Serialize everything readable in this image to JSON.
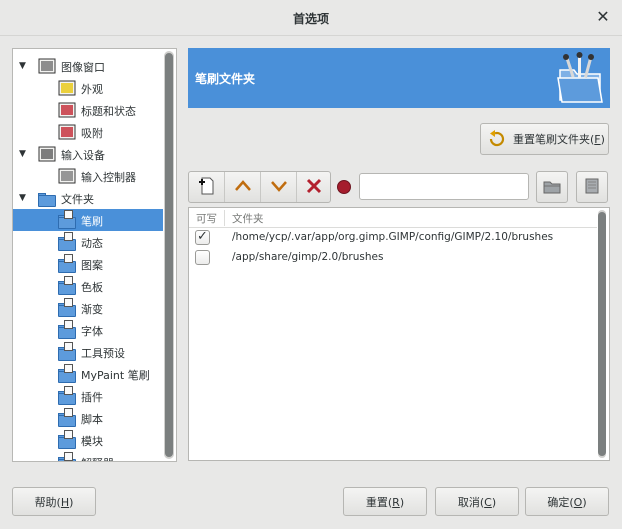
{
  "window": {
    "title": "首选项"
  },
  "sidebar": {
    "items": [
      {
        "label": "图像窗口",
        "icon": "image-window-icon",
        "level": 0,
        "expanded": true
      },
      {
        "label": "外观",
        "icon": "appearance-icon",
        "level": 1
      },
      {
        "label": "标题和状态",
        "icon": "title-status-icon",
        "level": 1
      },
      {
        "label": "吸附",
        "icon": "snap-magnet-icon",
        "level": 1
      },
      {
        "label": "输入设备",
        "icon": "input-devices-icon",
        "level": 0,
        "expanded": true
      },
      {
        "label": "输入控制器",
        "icon": "input-controller-icon",
        "level": 1
      },
      {
        "label": "文件夹",
        "icon": "folders-icon",
        "level": 0,
        "expanded": true
      },
      {
        "label": "笔刷",
        "icon": "brush-folder-icon",
        "level": 1,
        "selected": true
      },
      {
        "label": "动态",
        "icon": "dynamics-folder-icon",
        "level": 1
      },
      {
        "label": "图案",
        "icon": "pattern-folder-icon",
        "level": 1
      },
      {
        "label": "色板",
        "icon": "palette-folder-icon",
        "level": 1
      },
      {
        "label": "渐变",
        "icon": "gradient-folder-icon",
        "level": 1
      },
      {
        "label": "字体",
        "icon": "font-folder-icon",
        "level": 1
      },
      {
        "label": "工具预设",
        "icon": "tool-preset-folder-icon",
        "level": 1
      },
      {
        "label": "MyPaint 笔刷",
        "icon": "mypaint-brush-folder-icon",
        "level": 1
      },
      {
        "label": "插件",
        "icon": "plugin-folder-icon",
        "level": 1
      },
      {
        "label": "脚本",
        "icon": "script-folder-icon",
        "level": 1
      },
      {
        "label": "模块",
        "icon": "module-folder-icon",
        "level": 1
      },
      {
        "label": "解释器",
        "icon": "interpreter-folder-icon",
        "level": 1
      }
    ]
  },
  "header": {
    "title": "笔刷文件夹",
    "icon": "brush-folder-large-icon"
  },
  "reset_folders_button": {
    "label": "重置笔刷文件夹(",
    "mnemonic": "F",
    "suffix": ")"
  },
  "toolbar": {
    "new_icon": "new-folder-icon",
    "up_icon": "move-up-icon",
    "down_icon": "move-down-icon",
    "delete_icon": "delete-icon",
    "status_color": "#a51d2d",
    "path_value": "",
    "browse_icon": "browse-folder-icon",
    "clear_icon": "clear-folder-icon"
  },
  "folder_list": {
    "columns": [
      "可写",
      "文件夹"
    ],
    "rows": [
      {
        "writable": true,
        "path": "/home/ycp/.var/app/org.gimp.GIMP/config/GIMP/2.10/brushes"
      },
      {
        "writable": false,
        "path": "/app/share/gimp/2.0/brushes"
      }
    ]
  },
  "buttons": {
    "help": {
      "label": "帮助(",
      "mnemonic": "H",
      "suffix": ")"
    },
    "reset": {
      "label": "重置(",
      "mnemonic": "R",
      "suffix": ")"
    },
    "cancel": {
      "label": "取消(",
      "mnemonic": "C",
      "suffix": ")"
    },
    "ok": {
      "label": "确定(",
      "mnemonic": "O",
      "suffix": ")"
    }
  },
  "colors": {
    "accent": "#4a90d9",
    "background": "#e8e8e7"
  }
}
